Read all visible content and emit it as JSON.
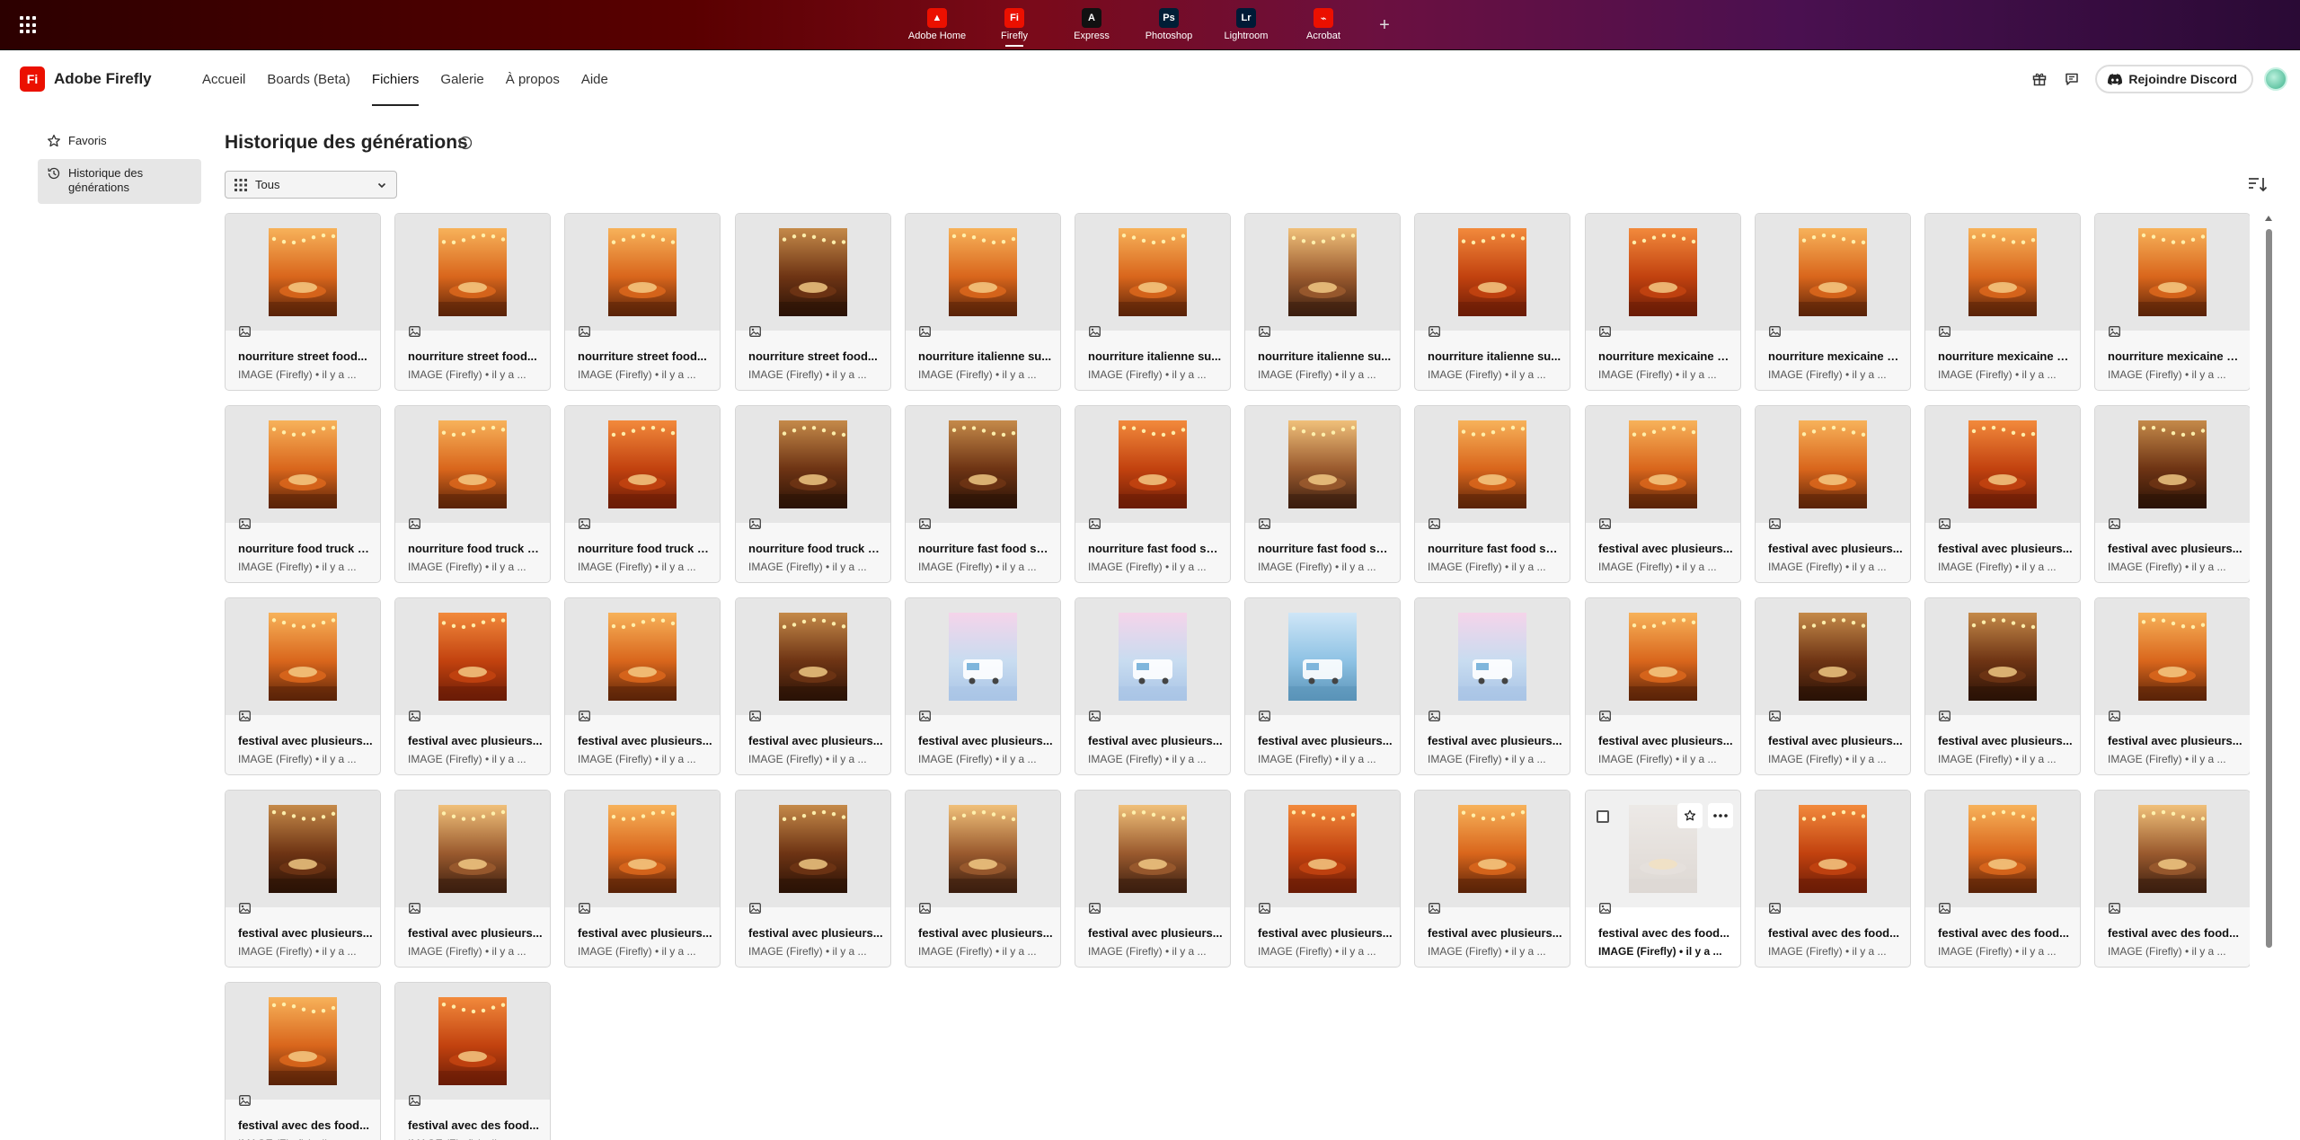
{
  "appbar": {
    "apps": [
      {
        "label": "Adobe Home",
        "icon": "adobe-home-icon",
        "glyph": "▲",
        "color": "#eb1000",
        "active": false
      },
      {
        "label": "Firefly",
        "icon": "firefly-icon",
        "glyph": "Fi",
        "color": "#eb1000",
        "active": true
      },
      {
        "label": "Express",
        "icon": "express-icon",
        "glyph": "A",
        "color": "#111111",
        "active": false
      },
      {
        "label": "Photoshop",
        "icon": "photoshop-icon",
        "glyph": "Ps",
        "color": "#001e36",
        "active": false
      },
      {
        "label": "Lightroom",
        "icon": "lightroom-icon",
        "glyph": "Lr",
        "color": "#001a36",
        "active": false
      },
      {
        "label": "Acrobat",
        "icon": "acrobat-icon",
        "glyph": "⌁",
        "color": "#eb1000",
        "active": false
      }
    ],
    "plus": "+"
  },
  "navbar": {
    "brand_logo": "Fi",
    "brand_name": "Adobe Firefly",
    "links": [
      {
        "label": "Accueil",
        "active": false
      },
      {
        "label": "Boards (Beta)",
        "active": false
      },
      {
        "label": "Fichiers",
        "active": true
      },
      {
        "label": "Galerie",
        "active": false
      },
      {
        "label": "À propos",
        "active": false
      },
      {
        "label": "Aide",
        "active": false
      }
    ],
    "discord_label": "Rejoindre Discord"
  },
  "sidebar": {
    "items": [
      {
        "label": "Favoris",
        "icon": "star-icon",
        "active": false
      },
      {
        "label": "Historique des générations",
        "icon": "history-icon",
        "active": true
      }
    ]
  },
  "main": {
    "title": "Historique des générations",
    "filter_label": "Tous",
    "cards": [
      {
        "title": "nourriture street food...",
        "sub": "IMAGE (Firefly) • il y a ...",
        "hue": "warm"
      },
      {
        "title": "nourriture street food...",
        "sub": "IMAGE (Firefly) • il y a ...",
        "hue": "warm"
      },
      {
        "title": "nourriture street food...",
        "sub": "IMAGE (Firefly) • il y a ...",
        "hue": "warm"
      },
      {
        "title": "nourriture street food...",
        "sub": "IMAGE (Firefly) • il y a ...",
        "hue": "dark"
      },
      {
        "title": "nourriture italienne su...",
        "sub": "IMAGE (Firefly) • il y a ...",
        "hue": "warm"
      },
      {
        "title": "nourriture italienne su...",
        "sub": "IMAGE (Firefly) • il y a ...",
        "hue": "warm"
      },
      {
        "title": "nourriture italienne su...",
        "sub": "IMAGE (Firefly) • il y a ...",
        "hue": "dusk"
      },
      {
        "title": "nourriture italienne su...",
        "sub": "IMAGE (Firefly) • il y a ...",
        "hue": "red"
      },
      {
        "title": "nourriture mexicaine s...",
        "sub": "IMAGE (Firefly) • il y a ...",
        "hue": "red"
      },
      {
        "title": "nourriture mexicaine s...",
        "sub": "IMAGE (Firefly) • il y a ...",
        "hue": "warm"
      },
      {
        "title": "nourriture mexicaine s...",
        "sub": "IMAGE (Firefly) • il y a ...",
        "hue": "warm"
      },
      {
        "title": "nourriture mexicaine s...",
        "sub": "IMAGE (Firefly) • il y a ...",
        "hue": "warm"
      },
      {
        "title": "nourriture food truck s...",
        "sub": "IMAGE (Firefly) • il y a ...",
        "hue": "warm"
      },
      {
        "title": "nourriture food truck s...",
        "sub": "IMAGE (Firefly) • il y a ...",
        "hue": "warm"
      },
      {
        "title": "nourriture food truck s...",
        "sub": "IMAGE (Firefly) • il y a ...",
        "hue": "red"
      },
      {
        "title": "nourriture food truck s...",
        "sub": "IMAGE (Firefly) • il y a ...",
        "hue": "dark"
      },
      {
        "title": "nourriture fast food su...",
        "sub": "IMAGE (Firefly) • il y a ...",
        "hue": "dark"
      },
      {
        "title": "nourriture fast food su...",
        "sub": "IMAGE (Firefly) • il y a ...",
        "hue": "red"
      },
      {
        "title": "nourriture fast food su...",
        "sub": "IMAGE (Firefly) • il y a ...",
        "hue": "dusk"
      },
      {
        "title": "nourriture fast food su...",
        "sub": "IMAGE (Firefly) • il y a ...",
        "hue": "warm"
      },
      {
        "title": "festival avec plusieurs...",
        "sub": "IMAGE (Firefly) • il y a ...",
        "hue": "warm"
      },
      {
        "title": "festival avec plusieurs...",
        "sub": "IMAGE (Firefly) • il y a ...",
        "hue": "warm"
      },
      {
        "title": "festival avec plusieurs...",
        "sub": "IMAGE (Firefly) • il y a ...",
        "hue": "red"
      },
      {
        "title": "festival avec plusieurs...",
        "sub": "IMAGE (Firefly) • il y a ...",
        "hue": "dark"
      },
      {
        "title": "festival avec plusieurs...",
        "sub": "IMAGE (Firefly) • il y a ...",
        "hue": "warm"
      },
      {
        "title": "festival avec plusieurs...",
        "sub": "IMAGE (Firefly) • il y a ...",
        "hue": "red"
      },
      {
        "title": "festival avec plusieurs...",
        "sub": "IMAGE (Firefly) • il y a ...",
        "hue": "warm"
      },
      {
        "title": "festival avec plusieurs...",
        "sub": "IMAGE (Firefly) • il y a ...",
        "hue": "dark"
      },
      {
        "title": "festival avec plusieurs...",
        "sub": "IMAGE (Firefly) • il y a ...",
        "hue": "pastel"
      },
      {
        "title": "festival avec plusieurs...",
        "sub": "IMAGE (Firefly) • il y a ...",
        "hue": "pastel"
      },
      {
        "title": "festival avec plusieurs...",
        "sub": "IMAGE (Firefly) • il y a ...",
        "hue": "sky"
      },
      {
        "title": "festival avec plusieurs...",
        "sub": "IMAGE (Firefly) • il y a ...",
        "hue": "pastel"
      },
      {
        "title": "festival avec plusieurs...",
        "sub": "IMAGE (Firefly) • il y a ...",
        "hue": "warm"
      },
      {
        "title": "festival avec plusieurs...",
        "sub": "IMAGE (Firefly) • il y a ...",
        "hue": "dark"
      },
      {
        "title": "festival avec plusieurs...",
        "sub": "IMAGE (Firefly) • il y a ...",
        "hue": "dark"
      },
      {
        "title": "festival avec plusieurs...",
        "sub": "IMAGE (Firefly) • il y a ...",
        "hue": "warm"
      },
      {
        "title": "festival avec plusieurs...",
        "sub": "IMAGE (Firefly) • il y a ...",
        "hue": "dark"
      },
      {
        "title": "festival avec plusieurs...",
        "sub": "IMAGE (Firefly) • il y a ...",
        "hue": "dusk"
      },
      {
        "title": "festival avec plusieurs...",
        "sub": "IMAGE (Firefly) • il y a ...",
        "hue": "warm"
      },
      {
        "title": "festival avec plusieurs...",
        "sub": "IMAGE (Firefly) • il y a ...",
        "hue": "dark"
      },
      {
        "title": "festival avec plusieurs...",
        "sub": "IMAGE (Firefly) • il y a ...",
        "hue": "dusk"
      },
      {
        "title": "festival avec plusieurs...",
        "sub": "IMAGE (Firefly) • il y a ...",
        "hue": "dusk"
      },
      {
        "title": "festival avec plusieurs...",
        "sub": "IMAGE (Firefly) • il y a ...",
        "hue": "red"
      },
      {
        "title": "festival avec plusieurs...",
        "sub": "IMAGE (Firefly) • il y a ...",
        "hue": "warm"
      },
      {
        "title": "festival avec des food...",
        "sub": "IMAGE (Firefly) • il y a ...",
        "hue": "faded",
        "hover": true
      },
      {
        "title": "festival avec des food...",
        "sub": "IMAGE (Firefly) • il y a ...",
        "hue": "red"
      },
      {
        "title": "festival avec des food...",
        "sub": "IMAGE (Firefly) • il y a ...",
        "hue": "warm"
      },
      {
        "title": "festival avec des food...",
        "sub": "IMAGE (Firefly) • il y a ...",
        "hue": "dusk"
      },
      {
        "title": "festival avec des food...",
        "sub": "IMAGE (Firefly) • il y a ...",
        "hue": "warm"
      },
      {
        "title": "festival avec des food...",
        "sub": "IMAGE (Firefly) • il y a ...",
        "hue": "red"
      }
    ]
  },
  "colors": {
    "accent_red": "#eb1000",
    "page_bg": "#ffffff",
    "card_bg": "#f7f7f7"
  }
}
